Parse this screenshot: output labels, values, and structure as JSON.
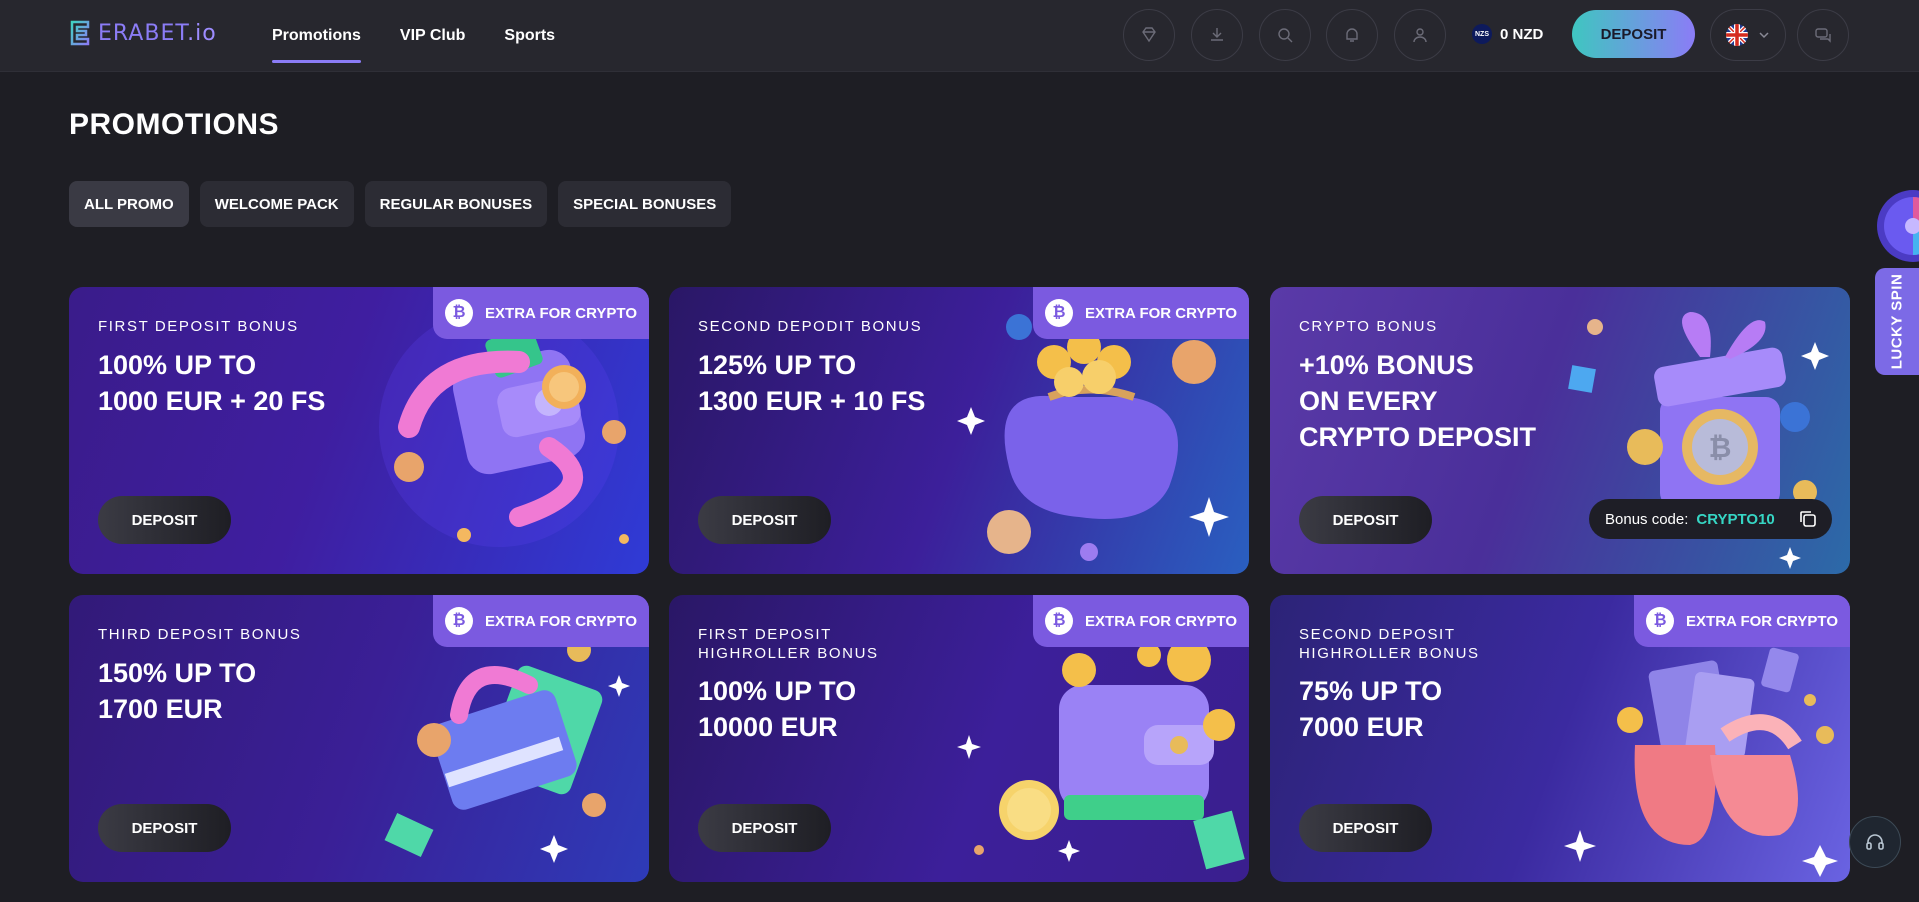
{
  "brand": {
    "name": "ERABET",
    "suffix": ".io"
  },
  "nav": [
    {
      "label": "Promotions",
      "active": true
    },
    {
      "label": "VIP Club",
      "active": false
    },
    {
      "label": "Sports",
      "active": false
    }
  ],
  "header": {
    "icons": [
      "diamond-icon",
      "download-icon",
      "search-icon",
      "bell-icon",
      "user-icon"
    ],
    "balance": {
      "currency_badge": "NZS",
      "amount": "0 NZD"
    },
    "deposit_label": "DEPOSIT",
    "language_icon": "uk-flag-icon"
  },
  "page": {
    "title": "PROMOTIONS"
  },
  "filters": [
    {
      "label": "ALL PROMO",
      "active": true
    },
    {
      "label": "WELCOME PACK",
      "active": false
    },
    {
      "label": "REGULAR BONUSES",
      "active": false
    },
    {
      "label": "SPECIAL BONUSES",
      "active": false
    }
  ],
  "cards": [
    {
      "subtitle": [
        "FIRST DEPOSIT BONUS"
      ],
      "headline": [
        "100% UP TO",
        "1000 EUR + 20 FS"
      ],
      "tag": "EXTRA FOR CRYPTO",
      "button": "DEPOSIT"
    },
    {
      "subtitle": [
        "SECOND DEPODIT BONUS"
      ],
      "headline": [
        "125% UP TO",
        "1300 EUR + 10 FS"
      ],
      "tag": "EXTRA FOR CRYPTO",
      "button": "DEPOSIT"
    },
    {
      "subtitle": [
        "CRYPTO BONUS"
      ],
      "headline": [
        "+10% BONUS",
        "ON EVERY",
        "CRYPTO DEPOSIT"
      ],
      "tag": "",
      "button": "DEPOSIT",
      "bonus_code_label": "Bonus code:",
      "bonus_code": "CRYPTO10"
    },
    {
      "subtitle": [
        "THIRD DEPOSIT BONUS"
      ],
      "headline": [
        "150% UP TO",
        "1700 EUR"
      ],
      "tag": "EXTRA FOR CRYPTO",
      "button": "DEPOSIT"
    },
    {
      "subtitle": [
        "FIRST DEPOSIT",
        "HIGHROLLER BONUS"
      ],
      "headline": [
        "100% UP TO",
        "10000 EUR"
      ],
      "tag": "EXTRA FOR CRYPTO",
      "button": "DEPOSIT"
    },
    {
      "subtitle": [
        "SECOND DEPOSIT",
        "HIGHROLLER BONUS"
      ],
      "headline": [
        "75% UP TO",
        "7000 EUR"
      ],
      "tag": "EXTRA FOR CRYPTO",
      "button": "DEPOSIT"
    }
  ],
  "side": {
    "lucky_spin": "LUCKY SPIN",
    "support_icon": "headset-icon"
  },
  "colors": {
    "accent": "#8b7cf6",
    "teal": "#36d6c4",
    "tag": "#7b5ae0",
    "background": "#1e1e24"
  }
}
